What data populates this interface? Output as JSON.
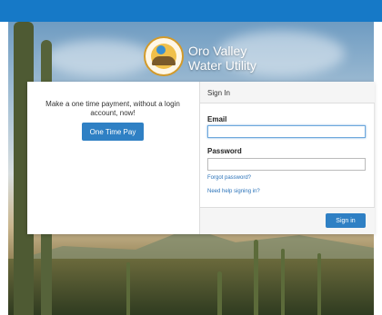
{
  "brand": {
    "line1": "Oro Valley",
    "line2": "Water Utility"
  },
  "payment": {
    "message": "Make a one time payment, without a login account, now!",
    "button_label": "One Time Pay"
  },
  "signin": {
    "heading": "Sign In",
    "email_label": "Email",
    "email_value": "",
    "password_label": "Password",
    "password_value": "",
    "forgot_link": "Forgot password?",
    "help_link": "Need help signing in?",
    "button_label": "Sign in"
  },
  "colors": {
    "topbar": "#1679c7",
    "primary_button": "#2f80c4",
    "link": "#2a72b8"
  }
}
